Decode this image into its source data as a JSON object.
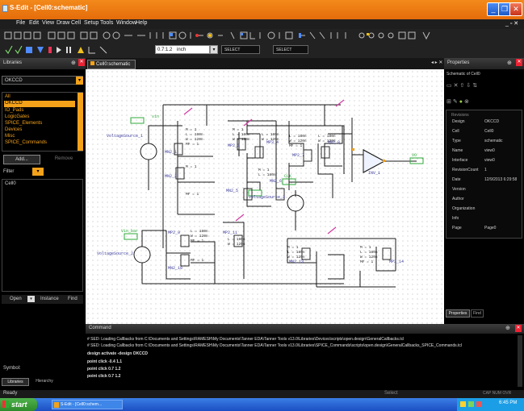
{
  "window": {
    "title": "S-Edit - [Cell0:schematic]"
  },
  "menu": [
    "File",
    "Edit",
    "View",
    "Draw",
    "Cell",
    "Setup",
    "Tools",
    "Window",
    "Help"
  ],
  "toolbar": {
    "zoom_value": "0.7:1.2",
    "units": "inch",
    "select_label_1": "SELECT",
    "select_label_2": "SELECT"
  },
  "libraries": {
    "title": "Libraries",
    "selected_library": "OKCCD",
    "items": [
      "All",
      "OKCCD",
      "IO_Pads",
      "LogicGates",
      "SPICE_Elements",
      "Devices",
      "Misc",
      "SPICE_Commands"
    ],
    "add_label": "Add...",
    "remove_label": "Remove",
    "filter_label": "Filter",
    "cell_item": "Cell0",
    "open_label": "Open",
    "instance_label": "Instance",
    "find_label": "Find",
    "symbol_label": "Symbol:",
    "tabs": [
      "Libraries",
      "Hierarchy"
    ]
  },
  "doc_tab": {
    "label": "Cell0:schematic"
  },
  "schematic": {
    "labels": {
      "vin": "vin",
      "vin_bar": "Vin_bar",
      "out": "VO",
      "v1": "VoltageSource_1",
      "v2": "VoltageSource_2",
      "v3": "VoltageSource_3",
      "inv": "INV_1",
      "m1": "MN2_1",
      "m2": "MN2_2",
      "m3": "MP2_3",
      "m4": "MP3_4",
      "m5": "MN2_5",
      "m6": "MN2_6",
      "m7": "MP2_7",
      "m8": "MN2_8",
      "m9": "MP2_9",
      "m10": "MN2_10",
      "m11": "MP2_11",
      "m12": "MP_12",
      "m13": "MN2_13",
      "m14": "MP3_14",
      "params": [
        "M = 1",
        "L = 180n",
        "W = 120n",
        "MF = 1"
      ],
      "clk": "CLK"
    }
  },
  "properties": {
    "title": "Properties",
    "subtitle": "Schematic of Cell0",
    "rows": [
      {
        "k": "Design",
        "v": "OKCCD"
      },
      {
        "k": "Cell",
        "v": "Cell0"
      },
      {
        "k": "Type",
        "v": "schematic"
      },
      {
        "k": "Name",
        "v": "view0"
      },
      {
        "k": "Interface",
        "v": "view0"
      },
      {
        "k": "RevisionCount",
        "v": "1"
      },
      {
        "k": "Date",
        "v": "12/9/2013 6:29:58"
      },
      {
        "k": "Version",
        "v": ""
      },
      {
        "k": "Author",
        "v": ""
      },
      {
        "k": "Organization",
        "v": ""
      },
      {
        "k": "Info",
        "v": ""
      },
      {
        "k": "Page",
        "v": "Page0"
      }
    ],
    "section_label": "Revisions",
    "tabs": [
      "Properties",
      "Find"
    ]
  },
  "command": {
    "title": "Command",
    "lines": [
      "# SED: Loading Callbacks from C:\\Documents and Settings\\RAMESH\\My Documents\\Tanner EDA\\Tanner Tools v13.0\\Libraries\\Devices\\scripts\\open.design\\GeneralCallbacks.tcl",
      "# SED: Loading Callbacks from C:\\Documents and Settings\\RAMESH\\My Documents\\Tanner EDA\\Tanner Tools v13.0\\Libraries\\SPICE_Commands\\scripts\\open.design\\GeneralCallbacks_SPICE_Commands.tcl",
      "design activate -design OKCCD",
      "point click -0.4 1.1",
      "point click 0.7 1.2",
      "point click 0.7 1.2"
    ]
  },
  "status": {
    "ready": "Ready",
    "select": "Select",
    "indicators": "CAP  NUM  OVR"
  },
  "taskbar": {
    "start": "start",
    "task": "S-Edit - [Cell0:schem...",
    "clock": "6:45 PM"
  },
  "colors": {
    "accent_orange": "#e8780f",
    "selection": "#f3a21a",
    "wire": "#1a1a1a",
    "net_label": "#2fa83a"
  }
}
